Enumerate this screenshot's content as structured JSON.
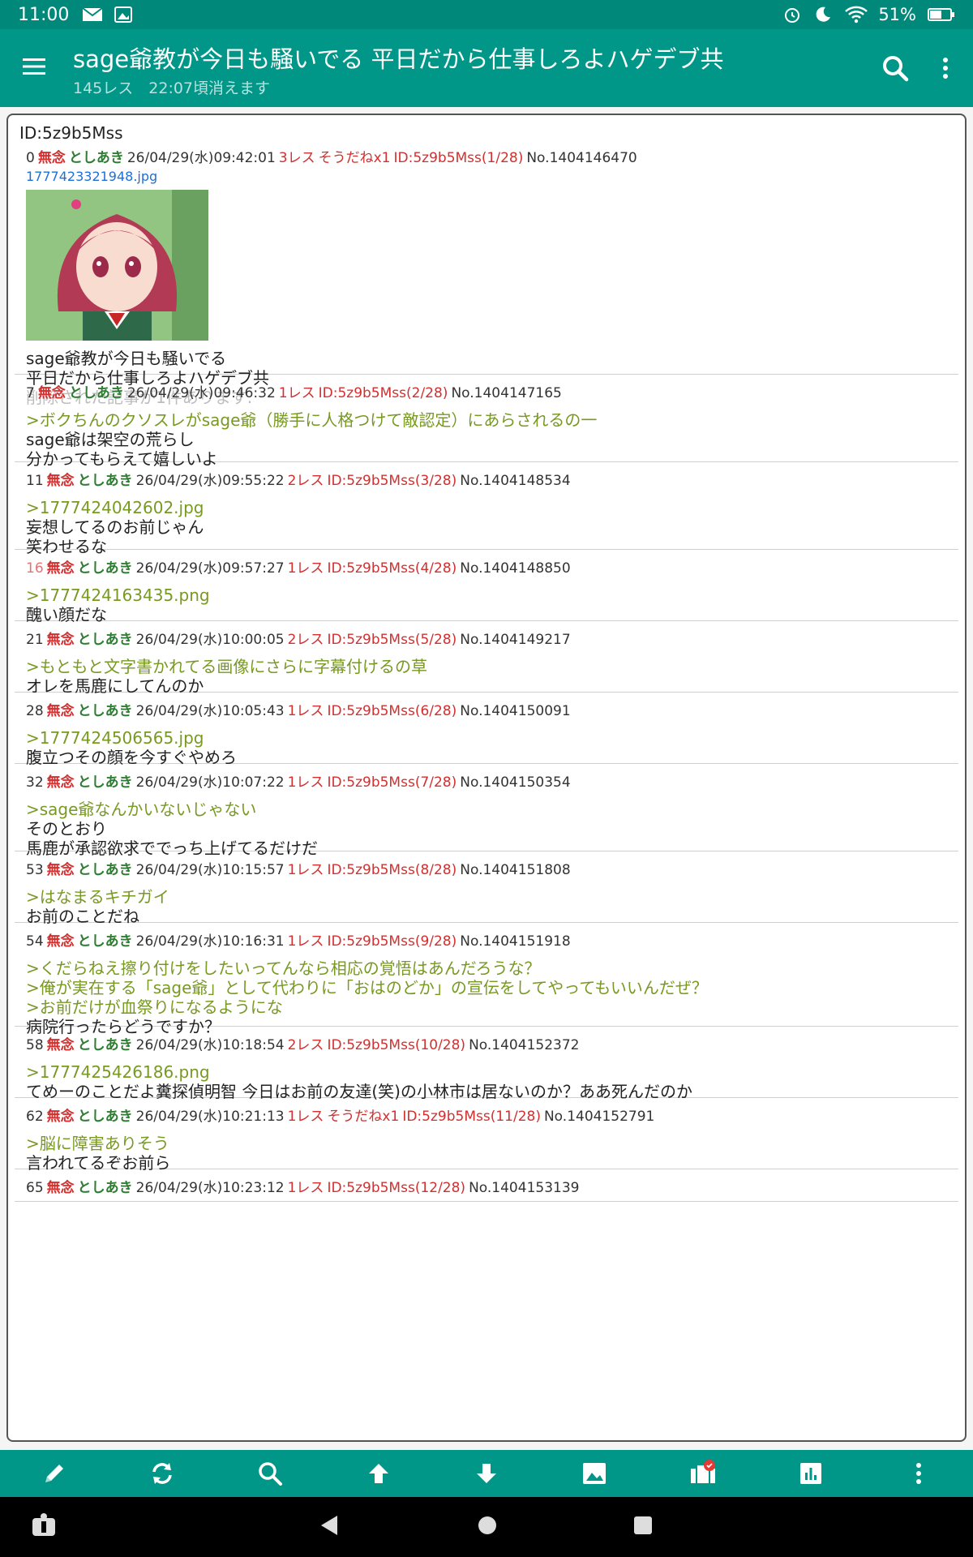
{
  "status_bar": {
    "time": "11:00",
    "battery": "51%"
  },
  "app_bar": {
    "title": "sage爺教が今日も騒いでる 平日だから仕事しろよハゲデブ共",
    "subtitle": "145レス　22:07頃消えます"
  },
  "popup": {
    "title": "ID:5z9b5Mss",
    "posts": [
      {
        "num": "0",
        "mun": "無念",
        "name": "としあき",
        "date": "26/04/29(水)09:42:01",
        "res": "3レス",
        "soudane": "そうだねx1",
        "id": "ID:5z9b5Mss(1/28)",
        "no": "No.1404146470",
        "file": "1777423321948.jpg",
        "lines": [
          "sage爺教が今日も騒いでる",
          "平日だから仕事しろよハゲデブ共"
        ],
        "deleted": "削除された記事が1件あります."
      },
      {
        "num": "7",
        "mun": "無念",
        "name": "としあき",
        "date": "26/04/29(水)09:46:32",
        "res": "1レス",
        "id": "ID:5z9b5Mss(2/28)",
        "no": "No.1404147165",
        "quotes": [
          ">ボクちんのクソスレがsage爺（勝手に人格つけて敵認定）にあらされるの一"
        ],
        "lines": [
          "sage爺は架空の荒らし",
          "分かってもらえて嬉しいよ"
        ]
      },
      {
        "num": "11",
        "mun": "無念",
        "name": "としあき",
        "date": "26/04/29(水)09:55:22",
        "res": "2レス",
        "id": "ID:5z9b5Mss(3/28)",
        "no": "No.1404148534",
        "quotes": [
          ">1777424042602.jpg"
        ],
        "lines": [
          "妄想してるのお前じゃん",
          "笑わせるな"
        ]
      },
      {
        "num": "16",
        "mun": "無念",
        "name": "としあき",
        "date": "26/04/29(水)09:57:27",
        "res": "1レス",
        "id": "ID:5z9b5Mss(4/28)",
        "no": "No.1404148850",
        "quotes": [
          ">1777424163435.png"
        ],
        "lines": [
          "醜い顔だな"
        ]
      },
      {
        "num": "21",
        "mun": "無念",
        "name": "としあき",
        "date": "26/04/29(水)10:00:05",
        "res": "2レス",
        "id": "ID:5z9b5Mss(5/28)",
        "no": "No.1404149217",
        "quotes": [
          ">もともと文字書かれてる画像にさらに字幕付けるの草"
        ],
        "lines": [
          "オレを馬鹿にしてんのか"
        ]
      },
      {
        "num": "28",
        "mun": "無念",
        "name": "としあき",
        "date": "26/04/29(水)10:05:43",
        "res": "1レス",
        "id": "ID:5z9b5Mss(6/28)",
        "no": "No.1404150091",
        "quotes": [
          ">1777424506565.jpg"
        ],
        "lines": [
          "腹立つその顔を今すぐやめろ"
        ]
      },
      {
        "num": "32",
        "mun": "無念",
        "name": "としあき",
        "date": "26/04/29(水)10:07:22",
        "res": "1レス",
        "id": "ID:5z9b5Mss(7/28)",
        "no": "No.1404150354",
        "quotes": [
          ">sage爺なんかいないじゃない"
        ],
        "lines": [
          "そのとおり",
          "馬鹿が承認欲求ででっち上げてるだけだ"
        ]
      },
      {
        "num": "53",
        "mun": "無念",
        "name": "としあき",
        "date": "26/04/29(水)10:15:57",
        "res": "1レス",
        "id": "ID:5z9b5Mss(8/28)",
        "no": "No.1404151808",
        "quotes": [
          ">はなまるキチガイ"
        ],
        "lines": [
          "お前のことだね"
        ]
      },
      {
        "num": "54",
        "mun": "無念",
        "name": "としあき",
        "date": "26/04/29(水)10:16:31",
        "res": "1レス",
        "id": "ID:5z9b5Mss(9/28)",
        "no": "No.1404151918",
        "quotes": [
          ">くだらねえ擦り付けをしたいってんなら相応の覚悟はあんだろうな？",
          ">俺が実在する「sage爺」として代わりに「おはのどか」の宣伝をしてやってもいいんだぜ？",
          ">お前だけが血祭りになるようにな"
        ],
        "lines": [
          "病院行ったらどうですか？"
        ]
      },
      {
        "num": "58",
        "mun": "無念",
        "name": "としあき",
        "date": "26/04/29(水)10:18:54",
        "res": "2レス",
        "id": "ID:5z9b5Mss(10/28)",
        "no": "No.1404152372",
        "quotes": [
          ">1777425426186.png"
        ],
        "lines": [
          "てめーのことだよ糞探偵明智 今日はお前の友達(笑)の小林市は居ないのか？ああ死んだのか"
        ]
      },
      {
        "num": "62",
        "mun": "無念",
        "name": "としあき",
        "date": "26/04/29(水)10:21:13",
        "res": "1レス",
        "soudane": "そうだねx1",
        "id": "ID:5z9b5Mss(11/28)",
        "no": "No.1404152791",
        "quotes": [
          ">脳に障害ありそう"
        ],
        "lines": [
          "言われてるぞお前ら"
        ]
      },
      {
        "num": "65",
        "mun": "無念",
        "name": "としあき",
        "date": "26/04/29(水)10:23:12",
        "res": "1レス",
        "id": "ID:5z9b5Mss(12/28)",
        "no": "No.1404153139"
      }
    ]
  },
  "colors": {
    "app_bar": "#009688",
    "status_bar": "#00897b",
    "mun": "#d32f2f",
    "name": "#2e7d32",
    "quote": "#789922",
    "link": "#1e6fd9"
  },
  "icons": {
    "bottom_bar": [
      "pencil-icon",
      "refresh-icon",
      "search-icon",
      "arrow-up-icon",
      "arrow-down-icon",
      "image-icon",
      "media-icon",
      "chart-icon",
      "more-vert-icon"
    ]
  }
}
